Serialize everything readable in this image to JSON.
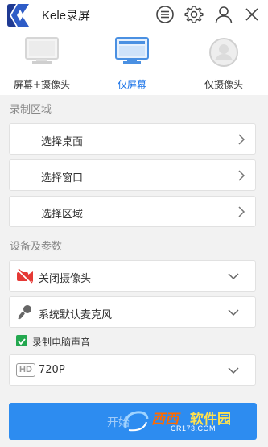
{
  "app": {
    "title": "Kele录屏"
  },
  "modes": [
    {
      "label": "屏幕+摄像头",
      "selected": false
    },
    {
      "label": "仅屏幕",
      "selected": true
    },
    {
      "label": "仅摄像头",
      "selected": false
    }
  ],
  "record_area": {
    "section_title": "录制区域",
    "items": [
      {
        "label": "选择桌面"
      },
      {
        "label": "选择窗口"
      },
      {
        "label": "选择区域"
      }
    ]
  },
  "settings": {
    "section_title": "设备及参数",
    "camera": {
      "label": "关闭摄像头",
      "icon": "camera-off-icon"
    },
    "microphone": {
      "label": "系统默认麦克风",
      "icon": "microphone-icon"
    },
    "record_audio": {
      "label": "录制电脑声音",
      "checked": true
    },
    "quality": {
      "badge": "HD",
      "label": "720P"
    }
  },
  "start_button": {
    "label": "开始"
  },
  "watermark": {
    "text1": "西西",
    "text2": "软件园",
    "sub": "CR173.COM"
  },
  "colors": {
    "accent": "#1a73e8",
    "start_button": "#2d8cf0",
    "checkbox": "#23a84f",
    "camera_off": "#e53935"
  }
}
